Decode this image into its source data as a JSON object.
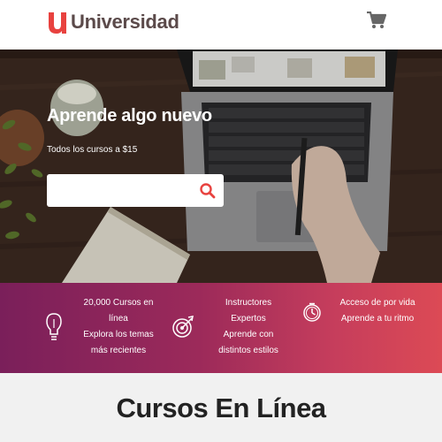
{
  "header": {
    "brand": "Universidad",
    "logo_letter": "u",
    "cart_icon": "shopping-cart-icon"
  },
  "hero": {
    "title": "Aprende algo nuevo",
    "subtitle": "Todos los cursos a $15",
    "search": {
      "value": "",
      "placeholder": "",
      "icon": "search-icon"
    }
  },
  "features": [
    {
      "icon": "lightbulb-icon",
      "lines": [
        "20,000 Cursos en",
        "línea",
        "Explora los temas",
        "más recientes"
      ]
    },
    {
      "icon": "target-icon",
      "lines": [
        "Instructores",
        "Expertos",
        "Aprende con",
        "distintos estilos"
      ]
    },
    {
      "icon": "clock-icon",
      "lines": [
        "Acceso de por vida",
        "Aprende a tu ritmo"
      ]
    }
  ],
  "section": {
    "title": "Cursos En Línea"
  },
  "colors": {
    "brand_red": "#e8423f",
    "gradient_start": "#7a1f5a",
    "gradient_end": "#dc4a55"
  }
}
